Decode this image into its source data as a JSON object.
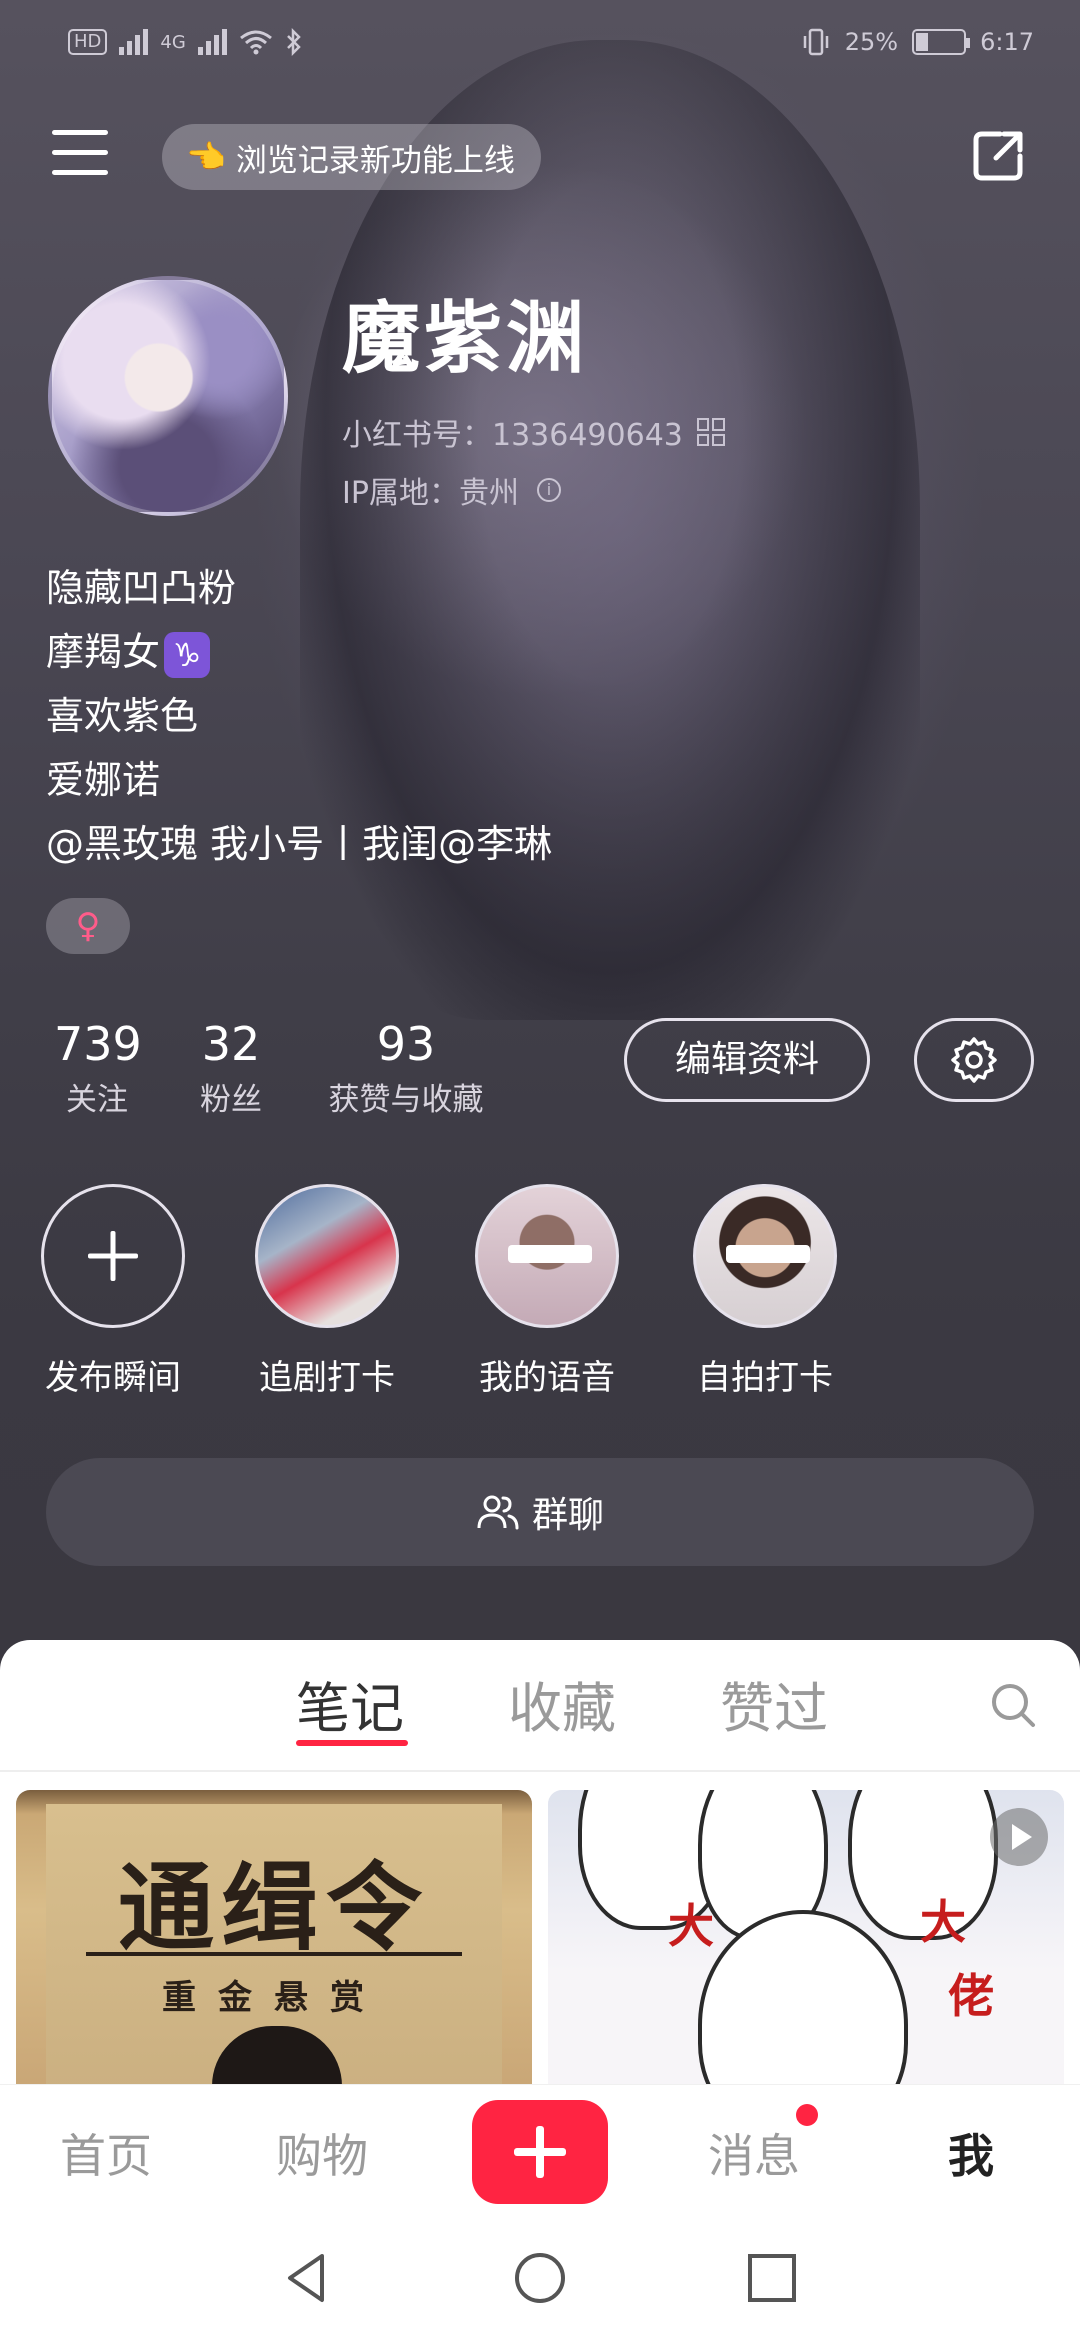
{
  "status_bar": {
    "left_badge": "HD",
    "network": "4G",
    "battery": "25%",
    "time": "6:17"
  },
  "topbar": {
    "notice": "浏览记录新功能上线",
    "notice_emoji": "👈"
  },
  "profile": {
    "name": "魔紫渊",
    "id_text": "小红书号：1336490643",
    "ip_text": "IP属地：贵州",
    "bio_lines": [
      "隐藏凹凸粉",
      "摩羯女",
      "喜欢紫色",
      "爱娜诺",
      "@黑玫瑰 我小号丨我闺@李琳"
    ],
    "zodiac_symbol": "♑",
    "gender_symbol": "♀"
  },
  "stats": [
    {
      "num": "739",
      "label": "关注"
    },
    {
      "num": "32",
      "label": "粉丝"
    },
    {
      "num": "93",
      "label": "获赞与收藏"
    }
  ],
  "actions": {
    "edit_label": "编辑资料",
    "settings_icon": "gear-icon"
  },
  "highlights": [
    {
      "label": "发布瞬间"
    },
    {
      "label": "追剧打卡"
    },
    {
      "label": "我的语音"
    },
    {
      "label": "自拍打卡"
    }
  ],
  "group_chat": {
    "label": "群聊"
  },
  "tabs": [
    {
      "label": "笔记",
      "active": true
    },
    {
      "label": "收藏",
      "active": false
    },
    {
      "label": "赞过",
      "active": false
    }
  ],
  "notes": [
    {
      "title_big": "通缉令",
      "subtitle": "重金悬赏"
    },
    {
      "red_text_1": "大",
      "red_text_2": "佬"
    }
  ],
  "bottom_nav": [
    {
      "label": "首页"
    },
    {
      "label": "购物"
    },
    {
      "label": "消息"
    },
    {
      "label": "我"
    }
  ],
  "colors": {
    "accent": "#ff2442",
    "header_bg": "#3a3840",
    "panel_bg": "#ffffff"
  }
}
